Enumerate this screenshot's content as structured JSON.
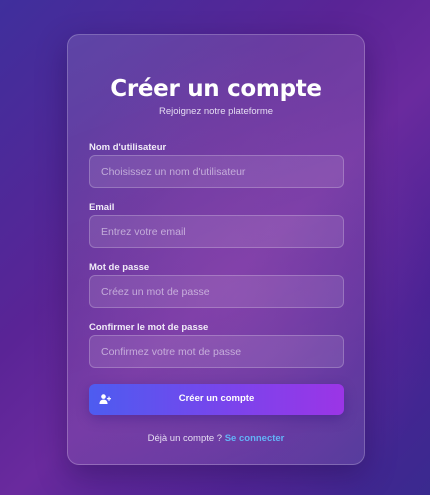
{
  "form": {
    "title": "Créer un compte",
    "subtitle": "Rejoignez notre plateforme",
    "fields": [
      {
        "label": "Nom d'utilisateur",
        "placeholder": "Choisissez un nom d'utilisateur",
        "value": ""
      },
      {
        "label": "Email",
        "placeholder": "Entrez votre email",
        "value": ""
      },
      {
        "label": "Mot de passe",
        "placeholder": "Créez un mot de passe",
        "value": ""
      },
      {
        "label": "Confirmer le mot de passe",
        "placeholder": "Confirmez votre mot de passe",
        "value": ""
      }
    ],
    "submit": {
      "label": "Créer un compte",
      "icon": "user-plus-icon"
    },
    "footer": {
      "text": "Déjà un compte ?",
      "link_label": "Se connecter"
    }
  },
  "colors": {
    "background_start": "#3f2f9c",
    "background_mid": "#5a2496",
    "button_start": "#4d5cf0",
    "button_end": "#9b35e6",
    "link": "#63b3f7"
  }
}
